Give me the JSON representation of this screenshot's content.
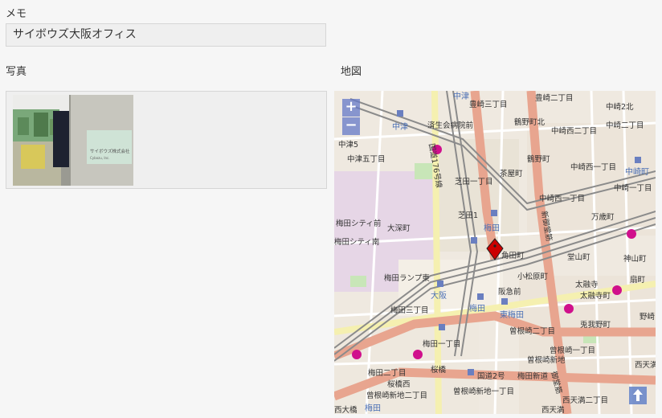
{
  "memo": {
    "label": "メモ",
    "value": "サイボウズ大阪オフィス"
  },
  "photo": {
    "label": "写真",
    "sign_text": "サイボウズ株式会社",
    "sign_subtext": "Cybozu, Inc."
  },
  "map": {
    "label": "地図",
    "zoom_in": "+",
    "zoom_out": "−",
    "places": [
      {
        "text": "中津",
        "kind": "station"
      },
      {
        "text": "豊崎三丁目"
      },
      {
        "text": "豊崎二丁目"
      },
      {
        "text": "中崎2北"
      },
      {
        "text": "中津"
      },
      {
        "text": "済生会病院前"
      },
      {
        "text": "鶴野町北"
      },
      {
        "text": "中崎西二丁目"
      },
      {
        "text": "中崎二丁目"
      },
      {
        "text": "中津5"
      },
      {
        "text": "国道176号線"
      },
      {
        "text": "中津五丁目"
      },
      {
        "text": "鶴野町"
      },
      {
        "text": "中崎西一丁目"
      },
      {
        "text": "中崎町",
        "kind": "station"
      },
      {
        "text": "茶屋町"
      },
      {
        "text": "芝田一丁目"
      },
      {
        "text": "中崎一丁目"
      },
      {
        "text": "中崎西一丁目"
      },
      {
        "text": "芝田1"
      },
      {
        "text": "梅田",
        "kind": "station"
      },
      {
        "text": "万歳町"
      },
      {
        "text": "梅田シティ前"
      },
      {
        "text": "大深町"
      },
      {
        "text": "梅田シティ南"
      },
      {
        "text": "角田町"
      },
      {
        "text": "堂山町"
      },
      {
        "text": "神山町"
      },
      {
        "text": "小松原町"
      },
      {
        "text": "扇町"
      },
      {
        "text": "梅田ランプ東"
      },
      {
        "text": "大阪",
        "kind": "station"
      },
      {
        "text": "阪急前"
      },
      {
        "text": "東梅田",
        "kind": "station"
      },
      {
        "text": "梅田",
        "kind": "station"
      },
      {
        "text": "梅田三丁目"
      },
      {
        "text": "曽根崎二丁目"
      },
      {
        "text": "太融寺"
      },
      {
        "text": "太融寺町"
      },
      {
        "text": "兎我野町"
      },
      {
        "text": "野崎"
      },
      {
        "text": "梅田一丁目"
      },
      {
        "text": "曽根崎新地"
      },
      {
        "text": "曾根崎一丁目"
      },
      {
        "text": "梅田二丁目"
      },
      {
        "text": "桜橋"
      },
      {
        "text": "国道2号"
      },
      {
        "text": "梅田新道"
      },
      {
        "text": "西天満"
      },
      {
        "text": "桜橋西"
      },
      {
        "text": "曾根崎新地二丁目"
      },
      {
        "text": "曽根崎新地一丁目"
      },
      {
        "text": "西天満二丁目"
      },
      {
        "text": "西天満"
      },
      {
        "text": "新御堂筋"
      },
      {
        "text": "御堂筋"
      },
      {
        "text": "梅田",
        "kind": "station"
      },
      {
        "text": "西大橋"
      }
    ]
  },
  "colors": {
    "page_bg": "#f6f6f6",
    "field_bg": "#efefef",
    "field_border": "#d6d6d6",
    "map_bg": "#efe9e0",
    "road_major": "#e8a58f",
    "road_secondary": "#f5f0b0",
    "rail": "#888888",
    "park": "#c8e6b8",
    "station": "#4a6fb5",
    "hospital": "#d0108c",
    "marker": "#cc0000"
  }
}
